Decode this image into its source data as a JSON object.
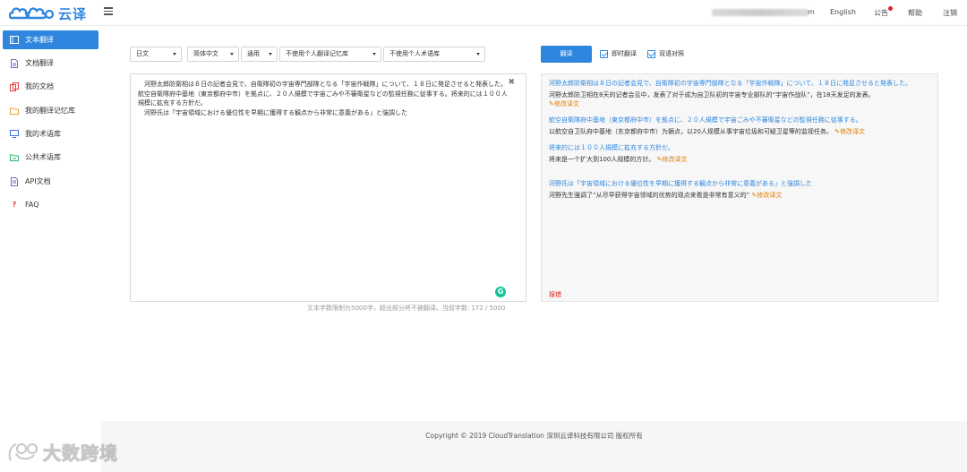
{
  "header": {
    "brand_name": "云译",
    "user_suffix": "m",
    "lang": "English",
    "notice": "公告",
    "help": "帮助",
    "logout": "注销"
  },
  "sidebar": {
    "items": [
      {
        "label": "文本翻译",
        "icon": "text-doc-icon",
        "active": true
      },
      {
        "label": "文档翻译",
        "icon": "document-icon",
        "active": false
      },
      {
        "label": "我的文档",
        "icon": "my-docs-icon",
        "active": false
      },
      {
        "label": "我的翻译记忆库",
        "icon": "folder-icon",
        "active": false
      },
      {
        "label": "我的术语库",
        "icon": "monitor-icon",
        "active": false
      },
      {
        "label": "公共术语库",
        "icon": "folder-share-icon",
        "active": false
      },
      {
        "label": "API文档",
        "icon": "api-doc-icon",
        "active": false
      },
      {
        "label": "FAQ",
        "icon": "question-icon",
        "active": false
      }
    ]
  },
  "toolbar": {
    "source_lang": "日文",
    "target_lang": "简体中文",
    "domain": "通用",
    "memory": "不使用个人翻译记忆库",
    "termbase": "不使用个人术语库",
    "translate_label": "翻译",
    "instant_label": "即时翻译",
    "bilingual_label": "双语对照"
  },
  "source": {
    "text": "　河野太郎防衛相は８日の記者会見で、自衛隊初の宇宙専門部隊となる「宇宙作戦隊」について、１８日に発足させると発表した。航空自衛隊府中基地（東京都府中市）を拠点に、２０人規模で宇宙ごみや不審衛星などの監視任務に従事する。将来的には１００人規模に拡充する方針だ。\n　河野氏は「宇宙領域における優位性を早期に獲得する観点から非常に意義がある」と強調した",
    "count_note": "文本字数限制为5000字，超出部分将不被翻译。当前字数: 172 / 5000"
  },
  "output": {
    "paragraphs": [
      {
        "src": "河野太郎防衛相は８日の記者会見で、自衛隊初の宇宙専門部隊となる「宇宙作戦隊」について、１８日に発足させると発表した。",
        "tr": "河野太郎防卫相在8天的记者会见中，发表了对于成为自卫队初的宇宙专业部队的“宇宙作战队”，在18天发足的发表。",
        "edit": "修改译文",
        "edit_newline": true
      },
      {
        "src": "航空自衛隊府中基地（東京都府中市）を拠点に、２０人規模で宇宙ごみや不審衛星などの監視任務に従事する。",
        "tr": "以航空自卫队府中基地（东京都府中市）为据点，以20人规模从事宇宙垃圾和可疑卫星等的监视任务。",
        "edit": "修改译文",
        "edit_newline": false
      },
      {
        "src": "将来的には１００人規模に拡充する方針だ。",
        "tr": "将来是一个扩大到100人规模的方针。",
        "edit": "修改译文",
        "edit_newline": false
      },
      {
        "src": "河野氏は「宇宙領域における優位性を早期に獲得する観点から非常に意義がある」と強調した",
        "tr": "河野先生强调了“从尽早获得宇宙领域的优势的观点来看是非常有意义的”",
        "edit": "修改译文",
        "edit_newline": false
      }
    ],
    "report": "报错"
  },
  "footer": {
    "copyright": "Copyright © 2019 CloudTranslation 深圳云译科技有限公司 版权所有"
  },
  "watermark": {
    "text": "大数跨境"
  },
  "colors": {
    "accent": "#2e86de",
    "edit": "#e07b00",
    "error": "#e02020"
  }
}
